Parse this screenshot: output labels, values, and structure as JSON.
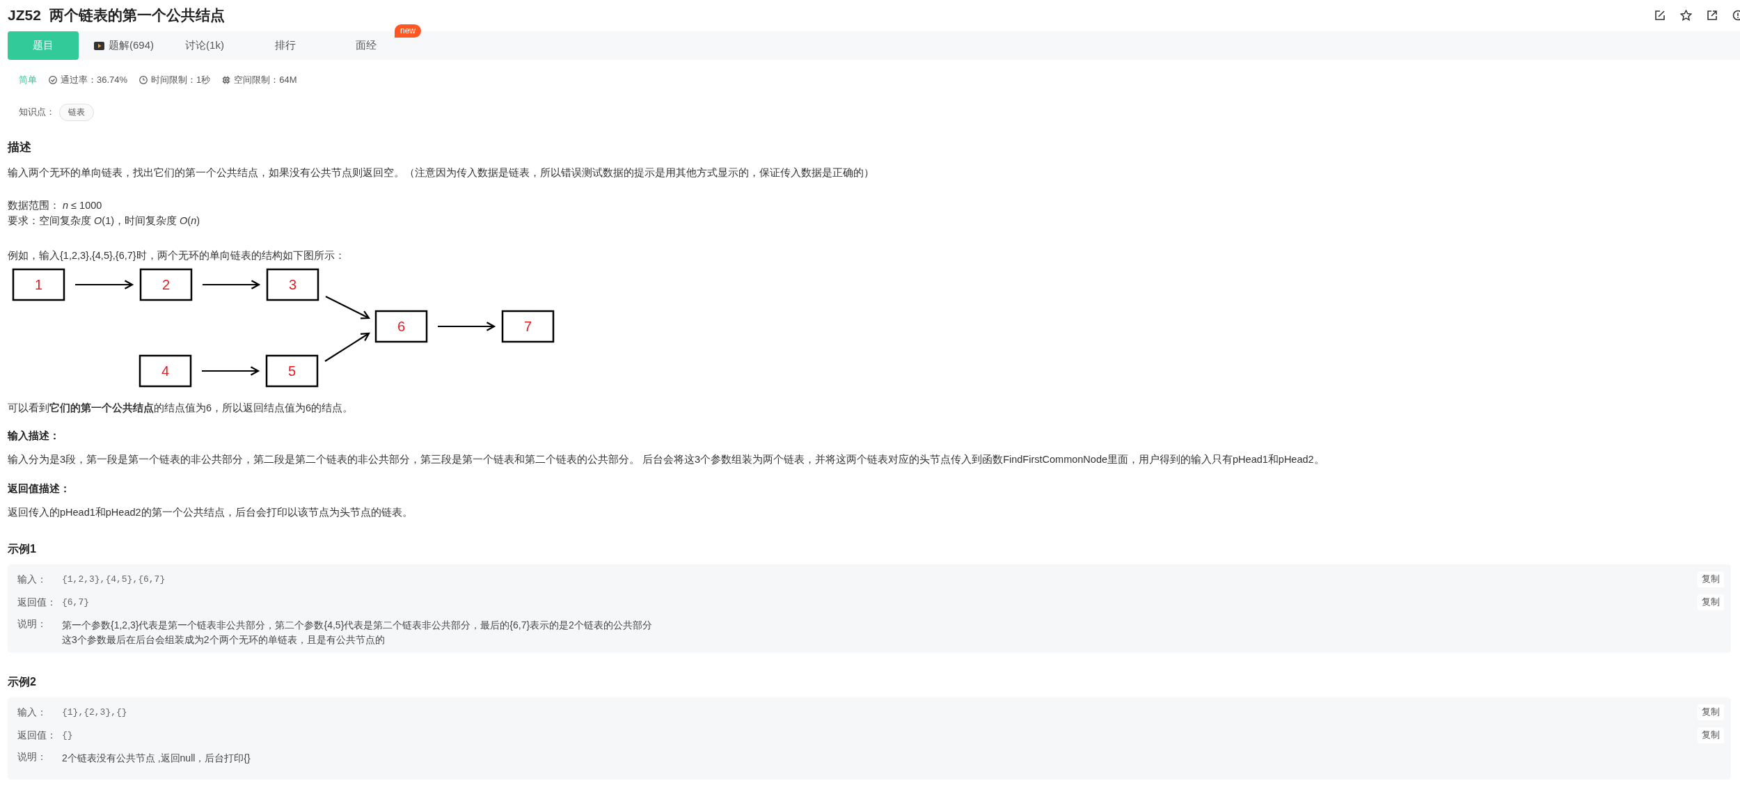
{
  "title": {
    "code": "JZ52",
    "name": "两个链表的第一个公共结点"
  },
  "tabs": [
    {
      "label": "题目",
      "selected": true,
      "kind": "plain"
    },
    {
      "label": "题解(694)",
      "selected": false,
      "kind": "video"
    },
    {
      "label": "讨论(1k)",
      "selected": false,
      "kind": "plain"
    },
    {
      "label": "排行",
      "selected": false,
      "kind": "plain"
    },
    {
      "label": "面经",
      "selected": false,
      "kind": "plain",
      "badge": "new"
    }
  ],
  "meta": {
    "difficulty": "简单",
    "pass_rate": "通过率：36.74%",
    "time_limit": "时间限制：1秒",
    "memory_limit": "空间限制：64M"
  },
  "knowledge": {
    "label": "知识点：",
    "tags": [
      "链表"
    ]
  },
  "description": {
    "heading": "描述",
    "intro": "输入两个无环的单向链表，找出它们的第一个公共结点，如果没有公共节点则返回空。（注意因为传入数据是链表，所以错误测试数据的提示是用其他方式显示的，保证传入数据是正确的）",
    "range": "数据范围： *n* ≤ 1000",
    "requirement": "要求：空间复杂度 *O*(1)，时间复杂度 *O*(*n*)",
    "example_intro": "例如，输入{1,2,3},{4,5},{6,7}时，两个无环的单向链表的结构如下图所示：",
    "diagram": {
      "nodes": [
        {
          "label": "1"
        },
        {
          "label": "2"
        },
        {
          "label": "3"
        },
        {
          "label": "4"
        },
        {
          "label": "5"
        },
        {
          "label": "6"
        },
        {
          "label": "7"
        }
      ]
    },
    "conclusion": "可以看到**它们的第一个公共结点**的结点值为6，所以返回结点值为6的结点。"
  },
  "input_description": {
    "heading": "输入描述：",
    "text": "输入分为是3段，第一段是第一个链表的非公共部分，第二段是第二个链表的非公共部分，第三段是第一个链表和第二个链表的公共部分。 后台会将这3个参数组装为两个链表，并将这两个链表对应的头节点传入到函数FindFirstCommonNode里面，用户得到的输入只有pHead1和pHead2。"
  },
  "return_description": {
    "heading": "返回值描述：",
    "text": "返回传入的pHead1和pHead2的第一个公共结点，后台会打印以该节点为头节点的链表。"
  },
  "examples": [
    {
      "title": "示例1",
      "rows": [
        {
          "kind": "value",
          "label": "输入：",
          "value": "{1,2,3},{4,5},{6,7}",
          "copy": "复制"
        },
        {
          "kind": "value",
          "label": "返回值：",
          "value": "{6,7}",
          "copy": "复制"
        },
        {
          "kind": "note",
          "label": "说明：",
          "lines": [
            "第一个参数{1,2,3}代表是第一个链表非公共部分，第二个参数{4,5}代表是第二个链表非公共部分，最后的{6,7}表示的是2个链表的公共部分",
            "这3个参数最后在后台会组装成为2个两个无环的单链表，且是有公共节点的"
          ]
        }
      ]
    },
    {
      "title": "示例2",
      "rows": [
        {
          "kind": "value",
          "label": "输入：",
          "value": "{1},{2,3},{}",
          "copy": "复制"
        },
        {
          "kind": "value",
          "label": "返回值：",
          "value": "{}",
          "copy": "复制"
        },
        {
          "kind": "note",
          "label": "说明：",
          "lines": [
            "2个链表没有公共节点 ,返回null，后台打印{}"
          ]
        }
      ]
    }
  ]
}
